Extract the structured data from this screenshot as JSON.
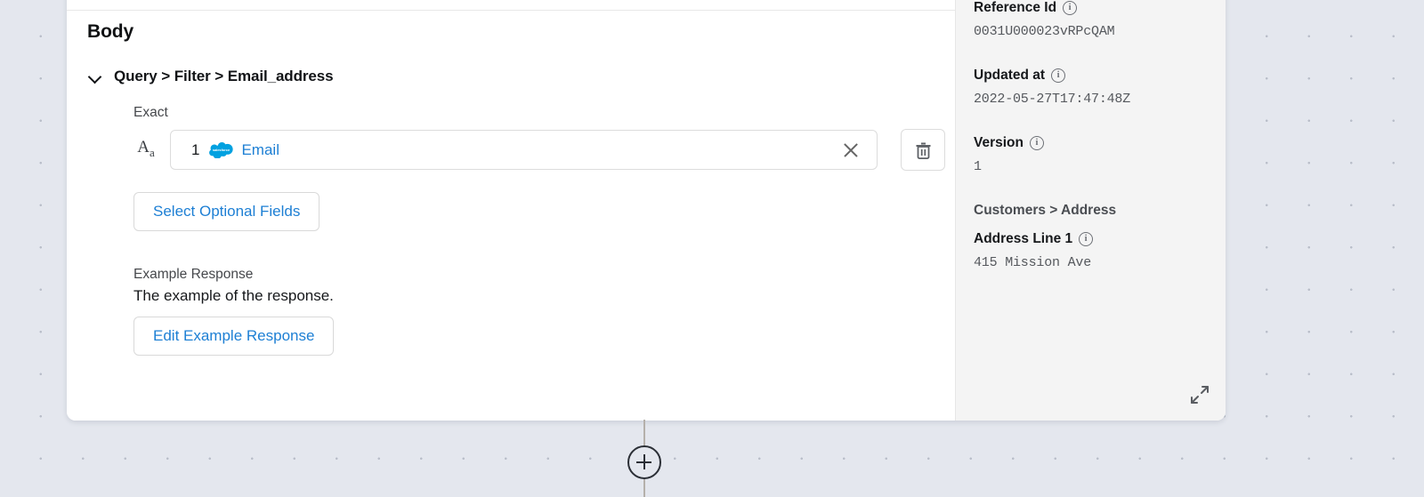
{
  "colors": {
    "canvas_bg": "#e4e7ee",
    "card_bg": "#ffffff",
    "panel_bg": "#f4f4f4",
    "link_blue": "#1d7fd4",
    "salesforce_blue": "#00a1e0",
    "text_dark": "#16181b",
    "text_muted": "#55585d",
    "connector": "#b5b0ab"
  },
  "body_section": {
    "title": "Body",
    "breadcrumb": "Query > Filter > Email_address",
    "collapse_icon": "chevron-down-icon",
    "field": {
      "label": "Exact",
      "type_icon": "text-format-icon",
      "token_number": "1",
      "token_logo": "salesforce-logo-icon",
      "token_text": "Email",
      "clear_icon": "close-icon",
      "delete_icon": "trash-icon"
    },
    "select_optional_fields_label": "Select Optional Fields",
    "example_response_label": "Example Response",
    "example_response_text": "The example of the response.",
    "edit_example_response_label": "Edit Example Response"
  },
  "details_panel": {
    "fields": [
      {
        "label": "Reference Id",
        "value": "0031U000023vRPcQAM",
        "info_icon": "info-icon"
      },
      {
        "label": "Updated at",
        "value": "2022-05-27T17:47:48Z",
        "info_icon": "info-icon"
      },
      {
        "label": "Version",
        "value": "1",
        "info_icon": "info-icon"
      }
    ],
    "group_heading": "Customers > Address",
    "address_field": {
      "label": "Address Line 1",
      "value": "415 Mission Ave",
      "info_icon": "info-icon"
    },
    "expand_icon": "expand-diagonal-icon"
  },
  "flow": {
    "add_node_icon": "plus-circle-icon"
  }
}
